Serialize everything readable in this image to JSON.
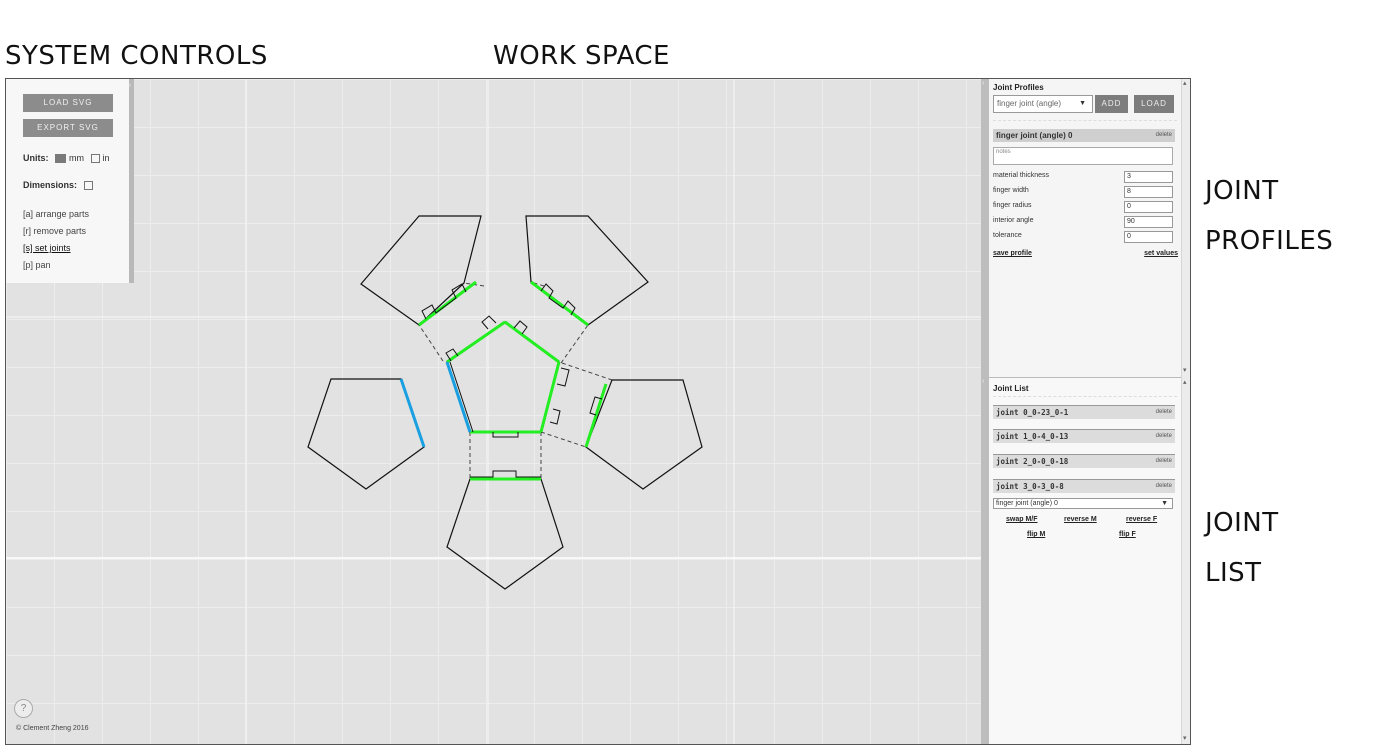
{
  "labels": {
    "system_controls": "SYSTEM CONTROLS",
    "work_space": "WORK SPACE",
    "joint_profiles_1": "JOINT",
    "joint_profiles_2": "PROFILES",
    "joint_list_1": "JOINT",
    "joint_list_2": "LIST"
  },
  "controls": {
    "load_svg": "LOAD SVG",
    "export_svg": "EXPORT SVG",
    "units_label": "Units:",
    "unit_mm": "mm",
    "unit_in": "in",
    "units_selected": "mm",
    "dimensions_label": "Dimensions:",
    "dimensions_checked": false,
    "modes": [
      {
        "label": "[a] arrange parts",
        "active": false
      },
      {
        "label": "[r] remove parts",
        "active": false
      },
      {
        "label": "[s] set joints",
        "active": true
      },
      {
        "label": "[p] pan",
        "active": false
      }
    ],
    "help": "?",
    "credit": "© Clement Zheng 2016"
  },
  "profiles": {
    "title": "Joint Profiles",
    "select_value": "finger joint (angle)",
    "add": "ADD",
    "load": "LOAD",
    "profile_name": "finger joint (angle) 0",
    "delete": "delete",
    "notes_placeholder": "notes",
    "params": [
      {
        "label": "material thickness",
        "value": "3"
      },
      {
        "label": "finger width",
        "value": "8"
      },
      {
        "label": "finger radius",
        "value": "0"
      },
      {
        "label": "interior angle",
        "value": "90"
      },
      {
        "label": "tolerance",
        "value": "0"
      }
    ],
    "save_profile": "save profile",
    "set_values": "set values"
  },
  "joint_list": {
    "title": "Joint List",
    "joints": [
      {
        "name": "joint 0_0-23_0-1",
        "delete": "delete"
      },
      {
        "name": "joint 1_0-4_0-13",
        "delete": "delete"
      },
      {
        "name": "joint 2_0-0_0-18",
        "delete": "delete"
      },
      {
        "name": "joint 3_0-3_0-8",
        "delete": "delete"
      }
    ],
    "selected_profile": "finger joint (angle) 0",
    "actions": {
      "swap": "swap M/F",
      "reverse_m": "reverse M",
      "reverse_f": "reverse F",
      "flip_m": "flip M",
      "flip_f": "flip F"
    }
  },
  "colors": {
    "joint_set": "#22ee22",
    "joint_selected": "#1a9fe0",
    "part_outline": "#111111",
    "workspace_bg": "#e2e2e2"
  }
}
